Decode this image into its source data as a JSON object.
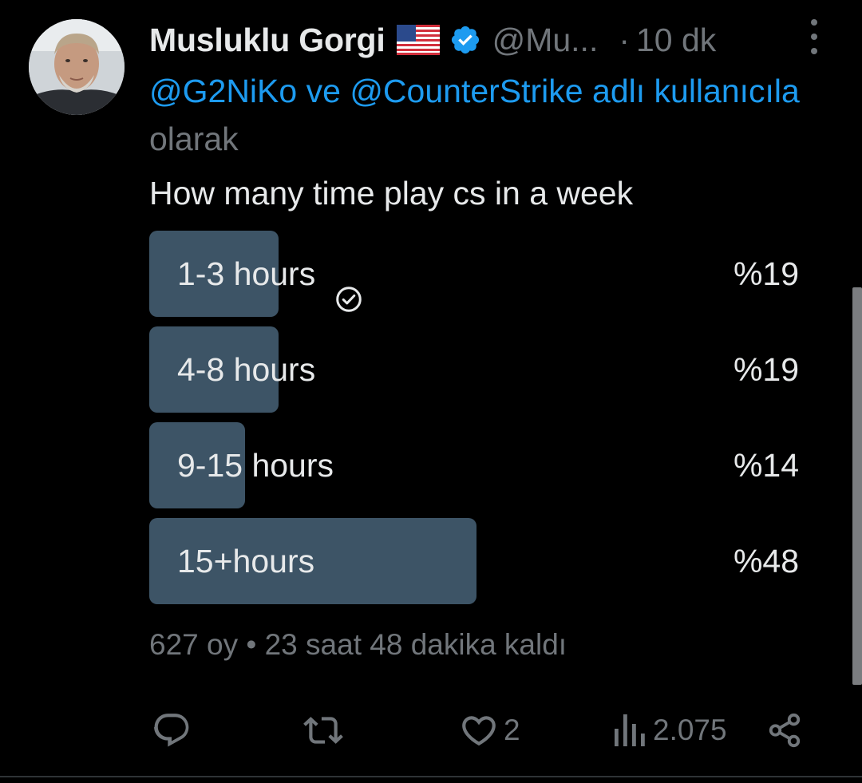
{
  "author": {
    "display_name": "Musluklu Gorgi",
    "handle": "@Mu...",
    "time_sep": "·",
    "time": "10 dk"
  },
  "reply_context": {
    "mentions": [
      "@G2NiKo",
      "@CounterStrike"
    ],
    "connector": "ve",
    "suffix": "adlı kullanıcıla",
    "line2": "olarak"
  },
  "tweet_text": "How many time play cs in a week",
  "poll": {
    "options": [
      {
        "label": "1-3 hours",
        "percent_label": "%19",
        "percent": 19,
        "voted": true
      },
      {
        "label": "4-8 hours",
        "percent_label": "%19",
        "percent": 19,
        "voted": false
      },
      {
        "label": "9-15 hours",
        "percent_label": "%14",
        "percent": 14,
        "voted": false
      },
      {
        "label": "15+hours",
        "percent_label": "%48",
        "percent": 48,
        "voted": false
      }
    ],
    "meta": "627 oy • 23 saat 48 dakika kaldı"
  },
  "actions": {
    "reply_count": "",
    "repost_count": "",
    "like_count": "2",
    "views_count": "2.075"
  },
  "icons": {
    "flag": "us-flag-icon",
    "verified": "verified-badge-icon",
    "more": "more-vertical-icon",
    "check": "check-circle-icon",
    "reply": "reply-icon",
    "repost": "repost-icon",
    "like": "heart-icon",
    "views": "views-icon",
    "share": "share-icon"
  },
  "colors": {
    "background": "#000000",
    "text": "#e7e9ea",
    "muted": "#71767b",
    "link": "#1d9bf0",
    "poll_bar": "#3d5466",
    "verified": "#1d9bf0"
  }
}
